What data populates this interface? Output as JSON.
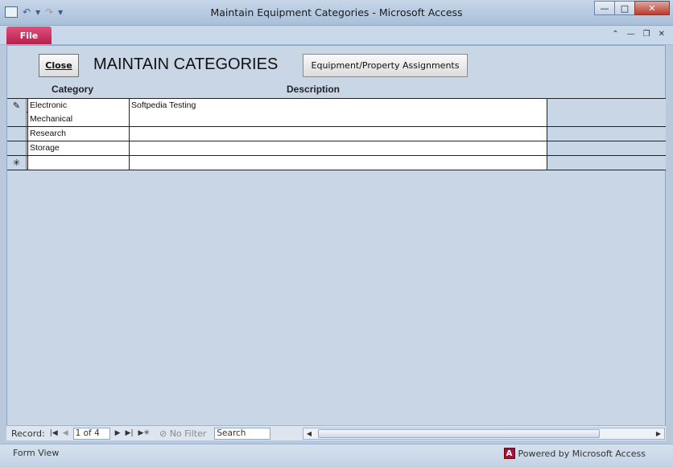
{
  "window": {
    "title": "Maintain Equipment Categories  -  Microsoft Access"
  },
  "ribbon": {
    "file_tab": "File"
  },
  "form": {
    "title": "MAINTAIN CATEGORIES",
    "close_label": "Close",
    "assign_label": "Equipment/Property Assignments",
    "col_category": "Category",
    "col_description": "Description",
    "rows": [
      {
        "selector": "✎",
        "category": "Electronic",
        "description": "Softpedia Testing"
      },
      {
        "selector": "",
        "category": "Mechanical",
        "description": ""
      },
      {
        "selector": "",
        "category": "Research",
        "description": ""
      },
      {
        "selector": "",
        "category": "Storage",
        "description": ""
      },
      {
        "selector": "✳",
        "category": "",
        "description": ""
      }
    ]
  },
  "navbar": {
    "record_label": "Record:",
    "position": "1 of 4",
    "no_filter": "No Filter",
    "search": "Search"
  },
  "status": {
    "view": "Form View",
    "powered": "Powered by Microsoft Access",
    "logo_letter": "A"
  }
}
